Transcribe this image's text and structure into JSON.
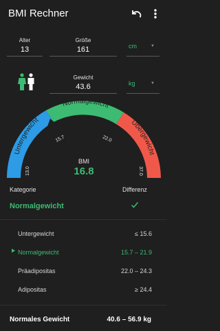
{
  "app": {
    "title": "BMI Rechner"
  },
  "inputs": {
    "age": {
      "label": "Alter",
      "value": "13"
    },
    "height": {
      "label": "Größe",
      "value": "161",
      "unit": "cm"
    },
    "weight": {
      "label": "Gewicht",
      "value": "43.6",
      "unit": "kg"
    },
    "gender_icon": "female-male-icon"
  },
  "gauge": {
    "segments": [
      {
        "name": "Untergewicht",
        "color": "#2d9be6"
      },
      {
        "name": "Normalgewicht",
        "color": "#3dbb73"
      },
      {
        "name": "Übergewicht",
        "color": "#f0594a"
      }
    ],
    "ticks": [
      "13.0",
      "15.7",
      "22.0",
      "37.0"
    ],
    "range": [
      13.0,
      37.0
    ],
    "bmi_label": "BMI",
    "bmi_value": "16.8",
    "bmi_numeric": 16.8
  },
  "category": {
    "label": "Kategorie",
    "diff_label": "Differenz",
    "value": "Normalgewicht",
    "diff_icon": "check-icon"
  },
  "ranges": [
    {
      "name": "Untergewicht",
      "range": "≤ 15.6",
      "active": false
    },
    {
      "name": "Normalgewicht",
      "range": "15.7 – 21.9",
      "active": true
    },
    {
      "name": "Präadipositas",
      "range": "22.0 – 24.3",
      "active": false
    },
    {
      "name": "Adipositas",
      "range": "≥ 24.4",
      "active": false
    }
  ],
  "footer": {
    "label": "Normales Gewicht",
    "value": "40.6 – 56.9 kg"
  },
  "colors": {
    "accent": "#3dbb73",
    "background": "#1f1f1f",
    "blue": "#2d9be6",
    "red": "#f0594a"
  }
}
